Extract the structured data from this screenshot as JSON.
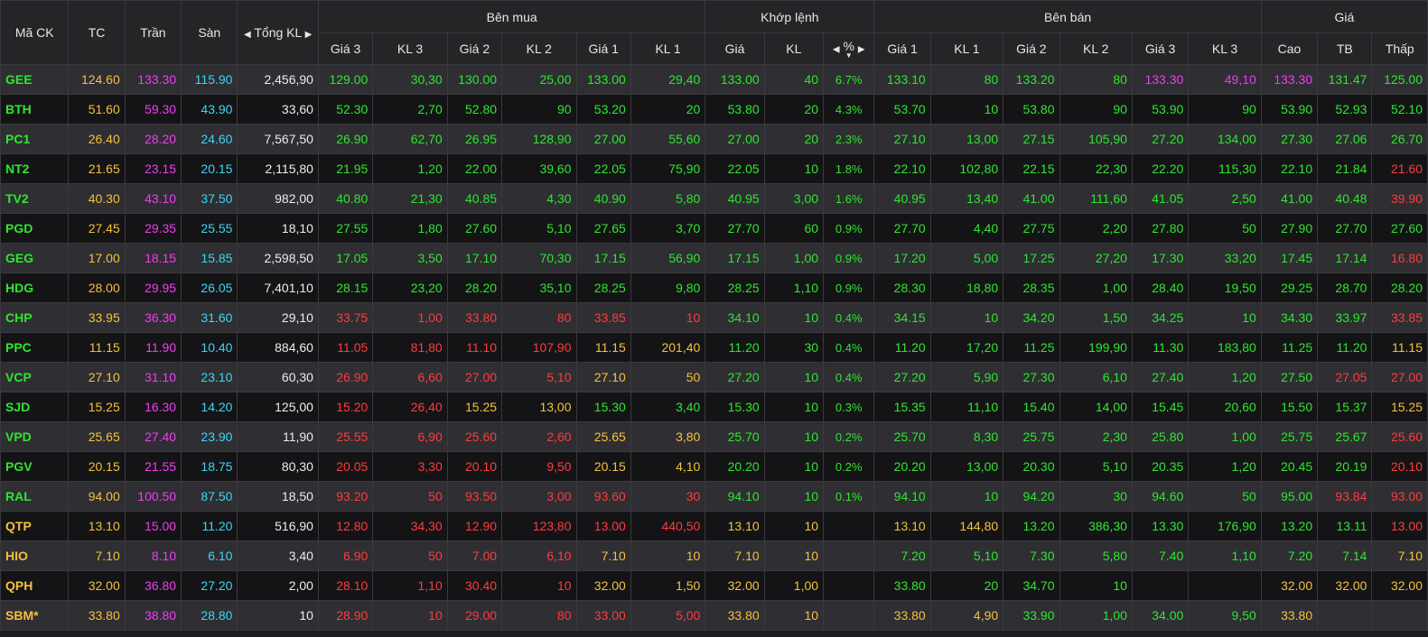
{
  "header": {
    "ma_ck": "Mã CK",
    "tc": "TC",
    "tran": "Trần",
    "san": "Sàn",
    "tong_kl": "Tổng KL",
    "groups": {
      "ben_mua": "Bên mua",
      "khop_lenh": "Khớp lệnh",
      "ben_ban": "Bên bán",
      "gia": "Giá"
    },
    "buy": [
      "Giá 3",
      "KL 3",
      "Giá 2",
      "KL 2",
      "Giá 1",
      "KL 1"
    ],
    "match": [
      "Giá",
      "KL",
      "%"
    ],
    "sell": [
      "Giá 1",
      "KL 1",
      "Giá 2",
      "KL 2",
      "Giá 3",
      "KL 3"
    ],
    "price": [
      "Cao",
      "TB",
      "Thấp"
    ]
  },
  "colors": {
    "up": "#2ee62e",
    "ref": "#f5c13b",
    "down": "#ff3b3b",
    "ceiling": "#f23bf2",
    "floor": "#3bd6f5",
    "neutral": "#ececec"
  },
  "rows": [
    {
      "c": [
        "GEE",
        "124.60",
        "133.30",
        "115.90",
        "2,456,90",
        "129.00",
        "30,30",
        "130.00",
        "25,00",
        "133.00",
        "29,40",
        "133.00",
        "40",
        "6.7%",
        "133.10",
        "80",
        "133.20",
        "80",
        "133.30",
        "49,10",
        "133.30",
        "131.47",
        "125.00"
      ],
      "k": [
        "g",
        "y",
        "p",
        "c",
        "w",
        "g",
        "g",
        "g",
        "g",
        "g",
        "g",
        "g",
        "g",
        "g",
        "g",
        "g",
        "g",
        "g",
        "p",
        "p",
        "p",
        "g",
        "g"
      ]
    },
    {
      "c": [
        "BTH",
        "51.60",
        "59.30",
        "43.90",
        "33,60",
        "52.30",
        "2,70",
        "52.80",
        "90",
        "53.20",
        "20",
        "53.80",
        "20",
        "4.3%",
        "53.70",
        "10",
        "53.80",
        "90",
        "53.90",
        "90",
        "53.90",
        "52.93",
        "52.10"
      ],
      "k": [
        "g",
        "y",
        "p",
        "c",
        "w",
        "g",
        "g",
        "g",
        "g",
        "g",
        "g",
        "g",
        "g",
        "g",
        "g",
        "g",
        "g",
        "g",
        "g",
        "g",
        "g",
        "g",
        "g"
      ]
    },
    {
      "c": [
        "PC1",
        "26.40",
        "28.20",
        "24.60",
        "7,567,50",
        "26.90",
        "62,70",
        "26.95",
        "128,90",
        "27.00",
        "55,60",
        "27.00",
        "20",
        "2.3%",
        "27.10",
        "13,00",
        "27.15",
        "105,90",
        "27.20",
        "134,00",
        "27.30",
        "27.06",
        "26.70"
      ],
      "k": [
        "g",
        "y",
        "p",
        "c",
        "w",
        "g",
        "g",
        "g",
        "g",
        "g",
        "g",
        "g",
        "g",
        "g",
        "g",
        "g",
        "g",
        "g",
        "g",
        "g",
        "g",
        "g",
        "g"
      ]
    },
    {
      "c": [
        "NT2",
        "21.65",
        "23.15",
        "20.15",
        "2,115,80",
        "21.95",
        "1,20",
        "22.00",
        "39,60",
        "22.05",
        "75,90",
        "22.05",
        "10",
        "1.8%",
        "22.10",
        "102,80",
        "22.15",
        "22,30",
        "22.20",
        "115,30",
        "22.10",
        "21.84",
        "21.60"
      ],
      "k": [
        "g",
        "y",
        "p",
        "c",
        "w",
        "g",
        "g",
        "g",
        "g",
        "g",
        "g",
        "g",
        "g",
        "g",
        "g",
        "g",
        "g",
        "g",
        "g",
        "g",
        "g",
        "g",
        "r"
      ]
    },
    {
      "c": [
        "TV2",
        "40.30",
        "43.10",
        "37.50",
        "982,00",
        "40.80",
        "21,30",
        "40.85",
        "4,30",
        "40.90",
        "5,80",
        "40.95",
        "3,00",
        "1.6%",
        "40.95",
        "13,40",
        "41.00",
        "111,60",
        "41.05",
        "2,50",
        "41.00",
        "40.48",
        "39.90"
      ],
      "k": [
        "g",
        "y",
        "p",
        "c",
        "w",
        "g",
        "g",
        "g",
        "g",
        "g",
        "g",
        "g",
        "g",
        "g",
        "g",
        "g",
        "g",
        "g",
        "g",
        "g",
        "g",
        "g",
        "r"
      ]
    },
    {
      "c": [
        "PGD",
        "27.45",
        "29.35",
        "25.55",
        "18,10",
        "27.55",
        "1,80",
        "27.60",
        "5,10",
        "27.65",
        "3,70",
        "27.70",
        "60",
        "0.9%",
        "27.70",
        "4,40",
        "27.75",
        "2,20",
        "27.80",
        "50",
        "27.90",
        "27.70",
        "27.60"
      ],
      "k": [
        "g",
        "y",
        "p",
        "c",
        "w",
        "g",
        "g",
        "g",
        "g",
        "g",
        "g",
        "g",
        "g",
        "g",
        "g",
        "g",
        "g",
        "g",
        "g",
        "g",
        "g",
        "g",
        "g"
      ]
    },
    {
      "c": [
        "GEG",
        "17.00",
        "18.15",
        "15.85",
        "2,598,50",
        "17.05",
        "3,50",
        "17.10",
        "70,30",
        "17.15",
        "56,90",
        "17.15",
        "1,00",
        "0.9%",
        "17.20",
        "5,00",
        "17.25",
        "27,20",
        "17.30",
        "33,20",
        "17.45",
        "17.14",
        "16.80"
      ],
      "k": [
        "g",
        "y",
        "p",
        "c",
        "w",
        "g",
        "g",
        "g",
        "g",
        "g",
        "g",
        "g",
        "g",
        "g",
        "g",
        "g",
        "g",
        "g",
        "g",
        "g",
        "g",
        "g",
        "r"
      ]
    },
    {
      "c": [
        "HDG",
        "28.00",
        "29.95",
        "26.05",
        "7,401,10",
        "28.15",
        "23,20",
        "28.20",
        "35,10",
        "28.25",
        "9,80",
        "28.25",
        "1,10",
        "0.9%",
        "28.30",
        "18,80",
        "28.35",
        "1,00",
        "28.40",
        "19,50",
        "29.25",
        "28.70",
        "28.20"
      ],
      "k": [
        "g",
        "y",
        "p",
        "c",
        "w",
        "g",
        "g",
        "g",
        "g",
        "g",
        "g",
        "g",
        "g",
        "g",
        "g",
        "g",
        "g",
        "g",
        "g",
        "g",
        "g",
        "g",
        "g"
      ]
    },
    {
      "c": [
        "CHP",
        "33.95",
        "36.30",
        "31.60",
        "29,10",
        "33.75",
        "1,00",
        "33.80",
        "80",
        "33.85",
        "10",
        "34.10",
        "10",
        "0.4%",
        "34.15",
        "10",
        "34.20",
        "1,50",
        "34.25",
        "10",
        "34.30",
        "33.97",
        "33.85"
      ],
      "k": [
        "g",
        "y",
        "p",
        "c",
        "w",
        "r",
        "r",
        "r",
        "r",
        "r",
        "r",
        "g",
        "g",
        "g",
        "g",
        "g",
        "g",
        "g",
        "g",
        "g",
        "g",
        "g",
        "r"
      ]
    },
    {
      "c": [
        "PPC",
        "11.15",
        "11.90",
        "10.40",
        "884,60",
        "11.05",
        "81,80",
        "11.10",
        "107,90",
        "11.15",
        "201,40",
        "11.20",
        "30",
        "0.4%",
        "11.20",
        "17,20",
        "11.25",
        "199,90",
        "11.30",
        "183,80",
        "11.25",
        "11.20",
        "11.15"
      ],
      "k": [
        "g",
        "y",
        "p",
        "c",
        "w",
        "r",
        "r",
        "r",
        "r",
        "y",
        "y",
        "g",
        "g",
        "g",
        "g",
        "g",
        "g",
        "g",
        "g",
        "g",
        "g",
        "g",
        "y"
      ]
    },
    {
      "c": [
        "VCP",
        "27.10",
        "31.10",
        "23.10",
        "60,30",
        "26.90",
        "6,60",
        "27.00",
        "5,10",
        "27.10",
        "50",
        "27.20",
        "10",
        "0.4%",
        "27.20",
        "5,90",
        "27.30",
        "6,10",
        "27.40",
        "1,20",
        "27.50",
        "27.05",
        "27.00"
      ],
      "k": [
        "g",
        "y",
        "p",
        "c",
        "w",
        "r",
        "r",
        "r",
        "r",
        "y",
        "y",
        "g",
        "g",
        "g",
        "g",
        "g",
        "g",
        "g",
        "g",
        "g",
        "g",
        "r",
        "r"
      ]
    },
    {
      "c": [
        "SJD",
        "15.25",
        "16.30",
        "14.20",
        "125,00",
        "15.20",
        "26,40",
        "15.25",
        "13,00",
        "15.30",
        "3,40",
        "15.30",
        "10",
        "0.3%",
        "15.35",
        "11,10",
        "15.40",
        "14,00",
        "15.45",
        "20,60",
        "15.50",
        "15.37",
        "15.25"
      ],
      "k": [
        "g",
        "y",
        "p",
        "c",
        "w",
        "r",
        "r",
        "y",
        "y",
        "g",
        "g",
        "g",
        "g",
        "g",
        "g",
        "g",
        "g",
        "g",
        "g",
        "g",
        "g",
        "g",
        "y"
      ]
    },
    {
      "c": [
        "VPD",
        "25.65",
        "27.40",
        "23.90",
        "11,90",
        "25.55",
        "6,90",
        "25.60",
        "2,60",
        "25.65",
        "3,80",
        "25.70",
        "10",
        "0.2%",
        "25.70",
        "8,30",
        "25.75",
        "2,30",
        "25.80",
        "1,00",
        "25.75",
        "25.67",
        "25.60"
      ],
      "k": [
        "g",
        "y",
        "p",
        "c",
        "w",
        "r",
        "r",
        "r",
        "r",
        "y",
        "y",
        "g",
        "g",
        "g",
        "g",
        "g",
        "g",
        "g",
        "g",
        "g",
        "g",
        "g",
        "r"
      ]
    },
    {
      "c": [
        "PGV",
        "20.15",
        "21.55",
        "18.75",
        "80,30",
        "20.05",
        "3,30",
        "20.10",
        "9,50",
        "20.15",
        "4,10",
        "20.20",
        "10",
        "0.2%",
        "20.20",
        "13,00",
        "20.30",
        "5,10",
        "20.35",
        "1,20",
        "20.45",
        "20.19",
        "20.10"
      ],
      "k": [
        "g",
        "y",
        "p",
        "c",
        "w",
        "r",
        "r",
        "r",
        "r",
        "y",
        "y",
        "g",
        "g",
        "g",
        "g",
        "g",
        "g",
        "g",
        "g",
        "g",
        "g",
        "g",
        "r"
      ]
    },
    {
      "c": [
        "RAL",
        "94.00",
        "100.50",
        "87.50",
        "18,50",
        "93.20",
        "50",
        "93.50",
        "3,00",
        "93.60",
        "30",
        "94.10",
        "10",
        "0.1%",
        "94.10",
        "10",
        "94.20",
        "30",
        "94.60",
        "50",
        "95.00",
        "93.84",
        "93.00"
      ],
      "k": [
        "g",
        "y",
        "p",
        "c",
        "w",
        "r",
        "r",
        "r",
        "r",
        "r",
        "r",
        "g",
        "g",
        "g",
        "g",
        "g",
        "g",
        "g",
        "g",
        "g",
        "g",
        "r",
        "r"
      ]
    },
    {
      "c": [
        "QTP",
        "13.10",
        "15.00",
        "11.20",
        "516,90",
        "12.80",
        "34,30",
        "12.90",
        "123,80",
        "13.00",
        "440,50",
        "13.10",
        "10",
        "",
        "13.10",
        "144,80",
        "13.20",
        "386,30",
        "13.30",
        "176,90",
        "13.20",
        "13.11",
        "13.00"
      ],
      "k": [
        "y",
        "y",
        "p",
        "c",
        "w",
        "r",
        "r",
        "r",
        "r",
        "r",
        "r",
        "y",
        "y",
        "y",
        "y",
        "y",
        "g",
        "g",
        "g",
        "g",
        "g",
        "g",
        "r"
      ]
    },
    {
      "c": [
        "HIO",
        "7.10",
        "8.10",
        "6.10",
        "3,40",
        "6.90",
        "50",
        "7.00",
        "6,10",
        "7.10",
        "10",
        "7.10",
        "10",
        "",
        "7.20",
        "5,10",
        "7.30",
        "5,80",
        "7.40",
        "1,10",
        "7.20",
        "7.14",
        "7.10"
      ],
      "k": [
        "y",
        "y",
        "p",
        "c",
        "w",
        "r",
        "r",
        "r",
        "r",
        "y",
        "y",
        "y",
        "y",
        "y",
        "g",
        "g",
        "g",
        "g",
        "g",
        "g",
        "g",
        "g",
        "y"
      ]
    },
    {
      "c": [
        "QPH",
        "32.00",
        "36.80",
        "27.20",
        "2,00",
        "28.10",
        "1,10",
        "30.40",
        "10",
        "32.00",
        "1,50",
        "32.00",
        "1,00",
        "",
        "33.80",
        "20",
        "34.70",
        "10",
        "",
        "",
        "32.00",
        "32.00",
        "32.00"
      ],
      "k": [
        "y",
        "y",
        "p",
        "c",
        "w",
        "r",
        "r",
        "r",
        "r",
        "y",
        "y",
        "y",
        "y",
        "y",
        "g",
        "g",
        "g",
        "g",
        "g",
        "g",
        "y",
        "y",
        "y"
      ]
    },
    {
      "c": [
        "SBM*",
        "33.80",
        "38.80",
        "28.80",
        "10",
        "28.90",
        "10",
        "29.00",
        "80",
        "33.00",
        "5,00",
        "33.80",
        "10",
        "",
        "33.80",
        "4,90",
        "33.90",
        "1,00",
        "34.00",
        "9,50",
        "33.80",
        "",
        ""
      ],
      "k": [
        "y",
        "y",
        "p",
        "c",
        "w",
        "r",
        "r",
        "r",
        "r",
        "r",
        "r",
        "y",
        "y",
        "y",
        "y",
        "y",
        "g",
        "g",
        "g",
        "g",
        "y",
        "y",
        "y"
      ]
    }
  ]
}
